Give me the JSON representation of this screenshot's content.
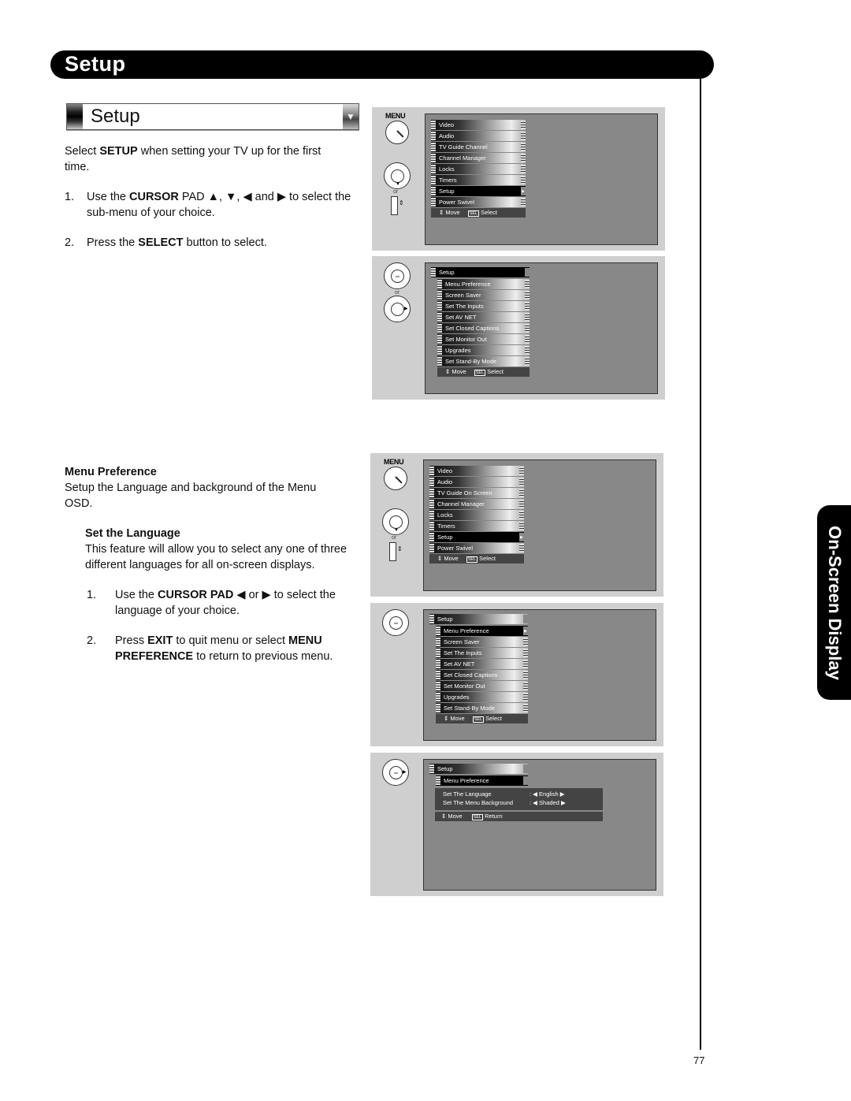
{
  "header": {
    "title": "Setup"
  },
  "side_tab": {
    "label": "On-Screen Display"
  },
  "page_number": "77",
  "setup_box": {
    "label": "Setup",
    "icon": "chevron-down-icon"
  },
  "intro": {
    "p1_pre": "Select ",
    "p1_bold": "SETUP",
    "p1_post": " when setting your TV up for the first time.",
    "step1_num": "1.",
    "step1_pre": "Use the ",
    "step1_bold": "CURSOR",
    "step1_post": " PAD ▲, ▼, ◀ and ▶ to select the sub-menu of your choice.",
    "step2_num": "2.",
    "step2_pre": "Press the ",
    "step2_bold": "SELECT",
    "step2_post": " button to select."
  },
  "menu_pref": {
    "heading": "Menu Preference",
    "desc": "Setup the Language and background of the Menu OSD.",
    "sub_heading": "Set the Language",
    "sub_desc": "This feature will allow you to select any one of three different languages for all on-screen displays.",
    "step1_num": "1.",
    "step1_pre": "Use the ",
    "step1_bold": "CURSOR PAD",
    "step1_post": " ◀ or ▶ to select the language of your choice.",
    "step2_num": "2.",
    "step2_pre": "Press ",
    "step2_bold1": "EXIT",
    "step2_mid": " to quit menu or select ",
    "step2_bold2": "MENU PREFERENCE",
    "step2_post": " to return to previous menu."
  },
  "remote": {
    "menu_label": "MENU",
    "or_label": "or"
  },
  "osd": {
    "main_menu_1": [
      "Video",
      "Audio",
      "TV Guide Channel",
      "Channel Manager",
      "Locks",
      "Timers",
      "Setup",
      "Power Swivel"
    ],
    "main_menu_2": [
      "Video",
      "Audio",
      "TV Guide On Screen",
      "Channel Manager",
      "Locks",
      "Timers",
      "Setup",
      "Power Swivel"
    ],
    "selected_main": "Setup",
    "setup_title": "Setup",
    "setup_menu": [
      "Menu Preference",
      "Screen Saver",
      "Set The Inputs",
      "Set AV NET",
      "Set Closed Captions",
      "Set Monitor Out",
      "Upgrades",
      "Set Stand-By Mode"
    ],
    "footer_move": "Move",
    "footer_sel_key": "SEL",
    "footer_select": "Select",
    "footer_return": "Return",
    "pref_title": "Menu Preference",
    "pref_rows": [
      {
        "label": "Set The Language",
        "value": "English"
      },
      {
        "label": "Set The Menu Background",
        "value": "Shaded"
      }
    ]
  }
}
